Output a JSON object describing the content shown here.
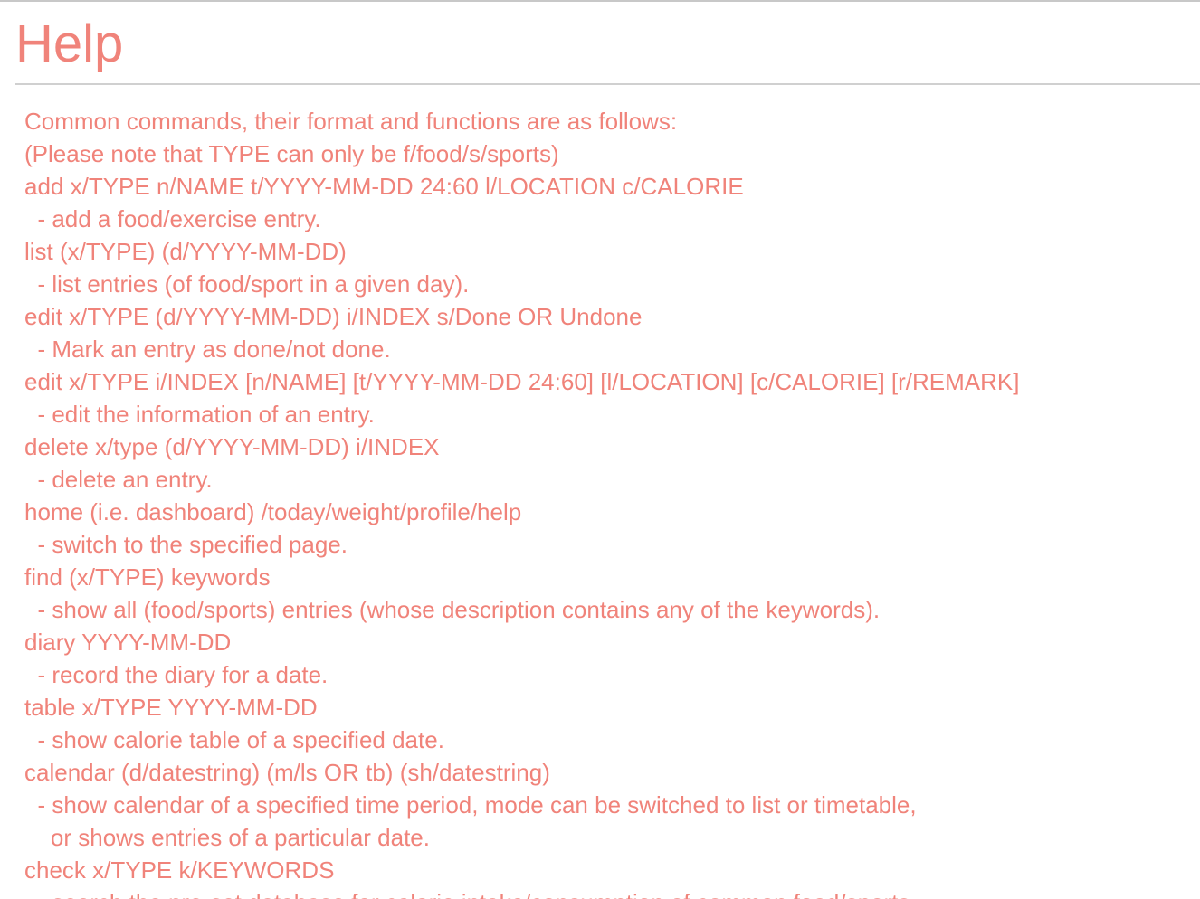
{
  "title": "Help",
  "colors": {
    "text": "#f0837a",
    "divider": "#d0d0d0"
  },
  "lines": [
    "Common commands, their format and functions are as follows:",
    "(Please note that TYPE can only be f/food/s/sports)",
    "add x/TYPE n/NAME t/YYYY-MM-DD 24:60 l/LOCATION c/CALORIE",
    "  - add a food/exercise entry.",
    "list (x/TYPE) (d/YYYY-MM-DD)",
    "  - list entries (of food/sport in a given day).",
    "edit x/TYPE (d/YYYY-MM-DD) i/INDEX s/Done OR Undone",
    "  - Mark an entry as done/not done.",
    "edit x/TYPE i/INDEX [n/NAME] [t/YYYY-MM-DD 24:60] [l/LOCATION] [c/CALORIE] [r/REMARK]",
    "  - edit the information of an entry.",
    "delete x/type (d/YYYY-MM-DD) i/INDEX",
    "  - delete an entry.",
    "home (i.e. dashboard) /today/weight/profile/help",
    "  - switch to the specified page.",
    "find (x/TYPE) keywords",
    "  - show all (food/sports) entries (whose description contains any of the keywords).",
    "diary YYYY-MM-DD",
    "  - record the diary for a date.",
    "table x/TYPE YYYY-MM-DD",
    "  - show calorie table of a specified date.",
    "calendar (d/datestring) (m/ls OR tb) (sh/datestring)",
    "  - show calendar of a specified time period, mode can be switched to list or timetable,",
    "    or shows entries of a particular date.",
    "check x/TYPE k/KEYWORDS",
    "  - search the pre-set database for calorie intake/consumption of common food/sports."
  ]
}
